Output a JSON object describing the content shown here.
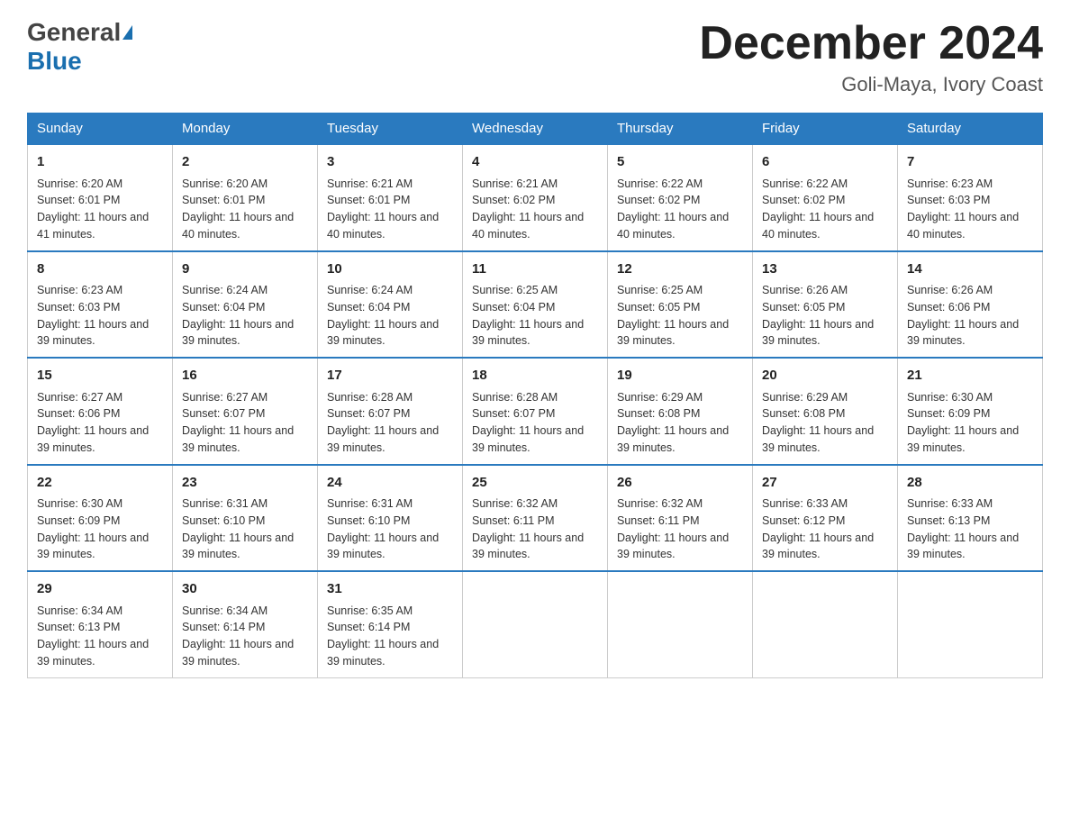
{
  "header": {
    "logo_general": "General",
    "logo_blue": "Blue",
    "month_title": "December 2024",
    "location": "Goli-Maya, Ivory Coast"
  },
  "days_of_week": [
    "Sunday",
    "Monday",
    "Tuesday",
    "Wednesday",
    "Thursday",
    "Friday",
    "Saturday"
  ],
  "weeks": [
    [
      {
        "day": "1",
        "sunrise": "6:20 AM",
        "sunset": "6:01 PM",
        "daylight": "11 hours and 41 minutes."
      },
      {
        "day": "2",
        "sunrise": "6:20 AM",
        "sunset": "6:01 PM",
        "daylight": "11 hours and 40 minutes."
      },
      {
        "day": "3",
        "sunrise": "6:21 AM",
        "sunset": "6:01 PM",
        "daylight": "11 hours and 40 minutes."
      },
      {
        "day": "4",
        "sunrise": "6:21 AM",
        "sunset": "6:02 PM",
        "daylight": "11 hours and 40 minutes."
      },
      {
        "day": "5",
        "sunrise": "6:22 AM",
        "sunset": "6:02 PM",
        "daylight": "11 hours and 40 minutes."
      },
      {
        "day": "6",
        "sunrise": "6:22 AM",
        "sunset": "6:02 PM",
        "daylight": "11 hours and 40 minutes."
      },
      {
        "day": "7",
        "sunrise": "6:23 AM",
        "sunset": "6:03 PM",
        "daylight": "11 hours and 40 minutes."
      }
    ],
    [
      {
        "day": "8",
        "sunrise": "6:23 AM",
        "sunset": "6:03 PM",
        "daylight": "11 hours and 39 minutes."
      },
      {
        "day": "9",
        "sunrise": "6:24 AM",
        "sunset": "6:04 PM",
        "daylight": "11 hours and 39 minutes."
      },
      {
        "day": "10",
        "sunrise": "6:24 AM",
        "sunset": "6:04 PM",
        "daylight": "11 hours and 39 minutes."
      },
      {
        "day": "11",
        "sunrise": "6:25 AM",
        "sunset": "6:04 PM",
        "daylight": "11 hours and 39 minutes."
      },
      {
        "day": "12",
        "sunrise": "6:25 AM",
        "sunset": "6:05 PM",
        "daylight": "11 hours and 39 minutes."
      },
      {
        "day": "13",
        "sunrise": "6:26 AM",
        "sunset": "6:05 PM",
        "daylight": "11 hours and 39 minutes."
      },
      {
        "day": "14",
        "sunrise": "6:26 AM",
        "sunset": "6:06 PM",
        "daylight": "11 hours and 39 minutes."
      }
    ],
    [
      {
        "day": "15",
        "sunrise": "6:27 AM",
        "sunset": "6:06 PM",
        "daylight": "11 hours and 39 minutes."
      },
      {
        "day": "16",
        "sunrise": "6:27 AM",
        "sunset": "6:07 PM",
        "daylight": "11 hours and 39 minutes."
      },
      {
        "day": "17",
        "sunrise": "6:28 AM",
        "sunset": "6:07 PM",
        "daylight": "11 hours and 39 minutes."
      },
      {
        "day": "18",
        "sunrise": "6:28 AM",
        "sunset": "6:07 PM",
        "daylight": "11 hours and 39 minutes."
      },
      {
        "day": "19",
        "sunrise": "6:29 AM",
        "sunset": "6:08 PM",
        "daylight": "11 hours and 39 minutes."
      },
      {
        "day": "20",
        "sunrise": "6:29 AM",
        "sunset": "6:08 PM",
        "daylight": "11 hours and 39 minutes."
      },
      {
        "day": "21",
        "sunrise": "6:30 AM",
        "sunset": "6:09 PM",
        "daylight": "11 hours and 39 minutes."
      }
    ],
    [
      {
        "day": "22",
        "sunrise": "6:30 AM",
        "sunset": "6:09 PM",
        "daylight": "11 hours and 39 minutes."
      },
      {
        "day": "23",
        "sunrise": "6:31 AM",
        "sunset": "6:10 PM",
        "daylight": "11 hours and 39 minutes."
      },
      {
        "day": "24",
        "sunrise": "6:31 AM",
        "sunset": "6:10 PM",
        "daylight": "11 hours and 39 minutes."
      },
      {
        "day": "25",
        "sunrise": "6:32 AM",
        "sunset": "6:11 PM",
        "daylight": "11 hours and 39 minutes."
      },
      {
        "day": "26",
        "sunrise": "6:32 AM",
        "sunset": "6:11 PM",
        "daylight": "11 hours and 39 minutes."
      },
      {
        "day": "27",
        "sunrise": "6:33 AM",
        "sunset": "6:12 PM",
        "daylight": "11 hours and 39 minutes."
      },
      {
        "day": "28",
        "sunrise": "6:33 AM",
        "sunset": "6:13 PM",
        "daylight": "11 hours and 39 minutes."
      }
    ],
    [
      {
        "day": "29",
        "sunrise": "6:34 AM",
        "sunset": "6:13 PM",
        "daylight": "11 hours and 39 minutes."
      },
      {
        "day": "30",
        "sunrise": "6:34 AM",
        "sunset": "6:14 PM",
        "daylight": "11 hours and 39 minutes."
      },
      {
        "day": "31",
        "sunrise": "6:35 AM",
        "sunset": "6:14 PM",
        "daylight": "11 hours and 39 minutes."
      },
      null,
      null,
      null,
      null
    ]
  ],
  "labels": {
    "sunrise_prefix": "Sunrise: ",
    "sunset_prefix": "Sunset: ",
    "daylight_prefix": "Daylight: "
  }
}
